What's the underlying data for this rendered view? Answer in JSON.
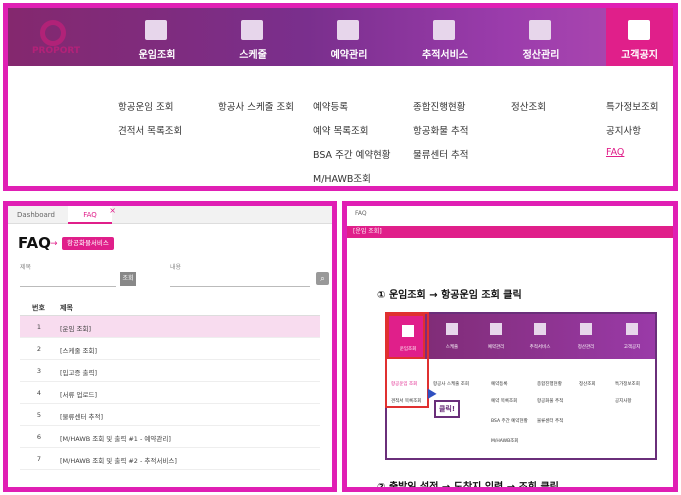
{
  "top": {
    "logo_text": "PROPORT",
    "nav": [
      {
        "label": "운임조회",
        "icon": "cargo-box-icon"
      },
      {
        "label": "스케줄",
        "icon": "calendar-icon"
      },
      {
        "label": "예약관리",
        "icon": "briefcase-icon"
      },
      {
        "label": "추적서비스",
        "icon": "plane-track-icon"
      },
      {
        "label": "정산관리",
        "icon": "chart-icon"
      },
      {
        "label": "고객공지",
        "icon": "chat-icon"
      }
    ],
    "menu": {
      "col1": [
        "항공운임 조회",
        "견적서 목록조회"
      ],
      "col2": [
        "항공사 스케줄 조회"
      ],
      "col3": [
        "예약등록",
        "예약 목록조회",
        "BSA 주간 예약현황",
        "M/HAWB조회"
      ],
      "col4": [
        "종합진행현황",
        "항공화물 추적",
        "물류센터 추적"
      ],
      "col5": [
        "정산조회"
      ],
      "col6": [
        "특가정보조회",
        "공지사항",
        "FAQ"
      ]
    }
  },
  "faq_panel": {
    "tabs": [
      "Dashboard",
      "FAQ"
    ],
    "title": "FAQ",
    "badge": "항공화물서비스",
    "search": {
      "label1": "제목",
      "label2": "내용",
      "button": "조회"
    },
    "headers": [
      "번호",
      "제목"
    ],
    "rows": [
      {
        "num": "1",
        "title": "[운임 조회]"
      },
      {
        "num": "2",
        "title": "[스케줄 조회]"
      },
      {
        "num": "3",
        "title": "[입고증 출력]"
      },
      {
        "num": "4",
        "title": "[서류 업로드]"
      },
      {
        "num": "5",
        "title": "[물류센터 추적]"
      },
      {
        "num": "6",
        "title": "[M/HAWB 조회 및 출력 #1 - 예약관리]"
      },
      {
        "num": "7",
        "title": "[M/HAWB 조회 및 출력 #2 - 추적서비스]"
      }
    ]
  },
  "detail_panel": {
    "caption": "FAQ",
    "bar_text": "[운임 조회]",
    "step1": "① 운임조회 → 항공운임 조회 클릭",
    "step2": "② 출발일 설정 → 도착지 입력 → 조회 클릭",
    "click_label": "클릭!",
    "mini_nav": [
      "운임조회",
      "스케줄",
      "예약관리",
      "추적서비스",
      "정산관리",
      "고객공지"
    ],
    "mini_menu": [
      "항공운임 조회",
      "항공사 스케줄 조회",
      "예약등록",
      "종합진행현황",
      "정산조회",
      "특가정보조회",
      "견적서 목록조회",
      "예약 목록조회",
      "항공화물 추적",
      "공지사항",
      "BSA 주간 예약현황",
      "물류센터 추적",
      "M/HAWB조회"
    ]
  }
}
